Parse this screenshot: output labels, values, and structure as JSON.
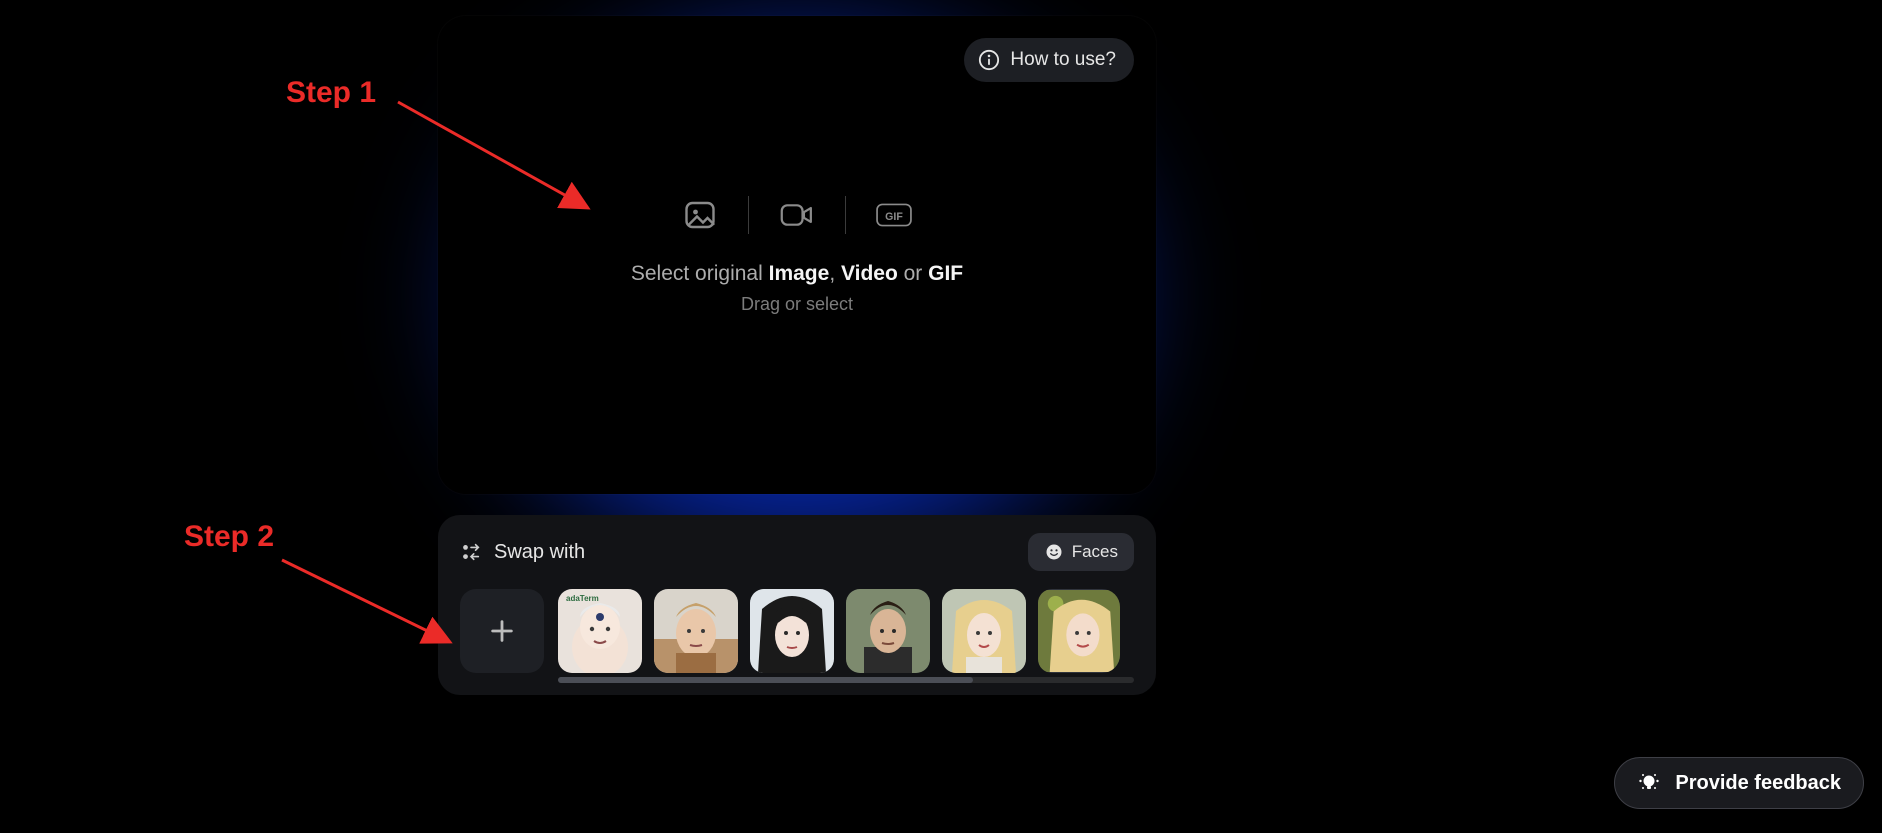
{
  "annotations": {
    "step1": "Step 1",
    "step2": "Step 2"
  },
  "drop": {
    "how_to_use": "How to use?",
    "line1_pre": "Select original ",
    "line1_b1": "Image",
    "line1_mid1": ", ",
    "line1_b2": "Video",
    "line1_mid2": " or ",
    "line1_b3": "GIF",
    "line2": "Drag or select"
  },
  "swap": {
    "title": "Swap with",
    "faces_label": "Faces",
    "faces": [
      {
        "name": "face-1"
      },
      {
        "name": "face-2"
      },
      {
        "name": "face-3"
      },
      {
        "name": "face-4"
      },
      {
        "name": "face-5"
      },
      {
        "name": "face-6"
      }
    ]
  },
  "feedback": {
    "label": "Provide feedback"
  }
}
